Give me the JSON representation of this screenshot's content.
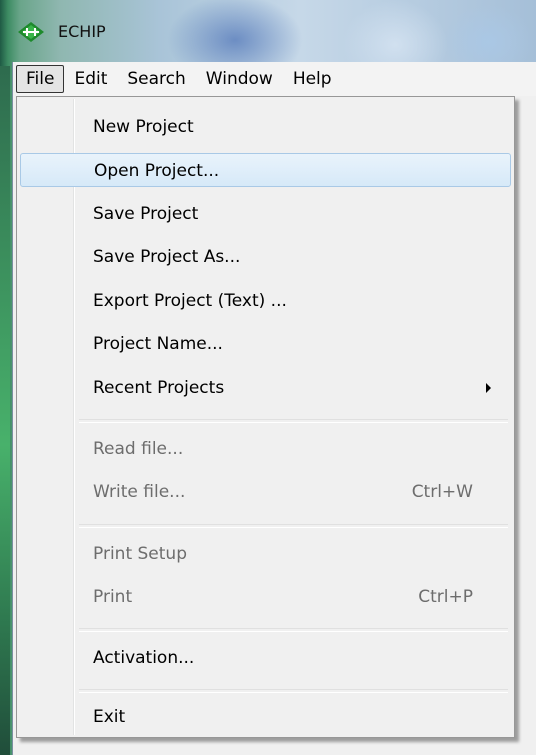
{
  "window": {
    "title": "ECHIP"
  },
  "menubar": {
    "items": [
      {
        "label": "File",
        "active": true
      },
      {
        "label": "Edit"
      },
      {
        "label": "Search"
      },
      {
        "label": "Window"
      },
      {
        "label": "Help"
      }
    ]
  },
  "file_menu": {
    "items": [
      {
        "label": "New Project"
      },
      {
        "label": "Open Project...",
        "state": "hover"
      },
      {
        "label": "Save Project"
      },
      {
        "label": "Save Project As..."
      },
      {
        "label": "Export Project (Text) ..."
      },
      {
        "label": "Project Name..."
      },
      {
        "label": "Recent Projects",
        "submenu": true
      },
      {
        "label": "Read file...",
        "disabled": true
      },
      {
        "label": "Write file...",
        "shortcut": "Ctrl+W",
        "disabled": true
      },
      {
        "label": "Print Setup",
        "disabled": true
      },
      {
        "label": "Print",
        "shortcut": "Ctrl+P",
        "disabled": true
      },
      {
        "label": "Activation..."
      },
      {
        "label": "Exit"
      }
    ]
  },
  "icons": {
    "app": "echip-app-icon",
    "submenu": "chevron-right-icon"
  }
}
